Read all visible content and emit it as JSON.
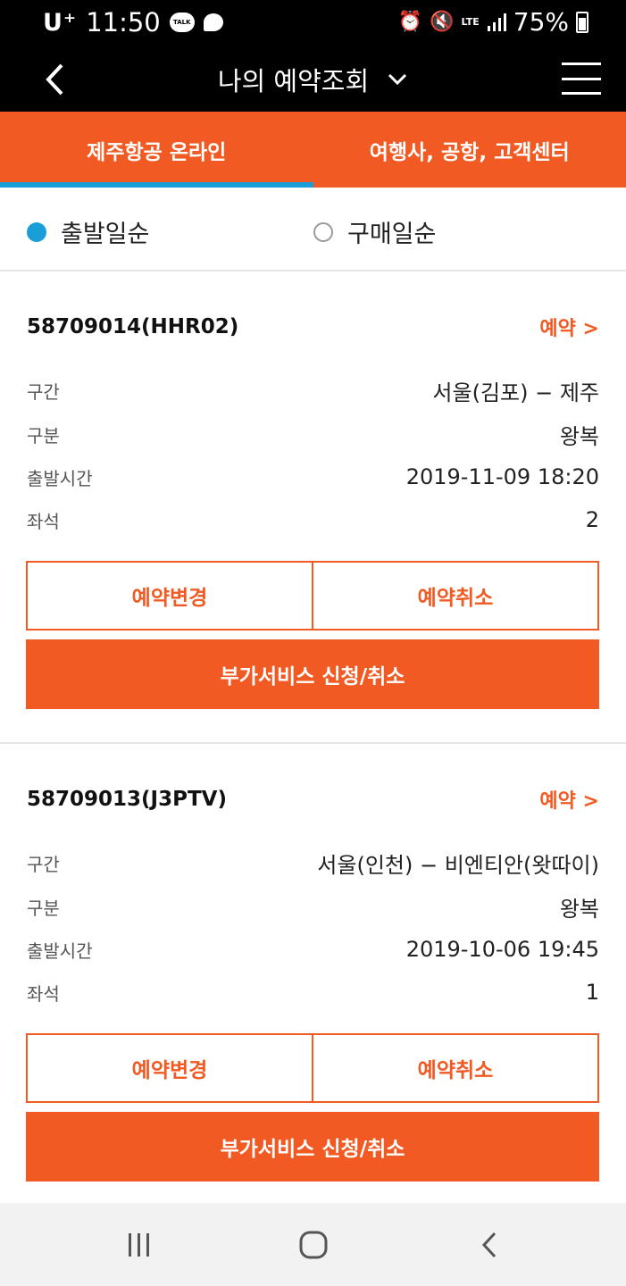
{
  "status_bar": {
    "carrier": "U⁺",
    "time": "11:50",
    "kakao_badge": "TALK",
    "network": "LTE",
    "battery": "75%"
  },
  "header": {
    "title": "나의 예약조회"
  },
  "tabs": [
    {
      "label": "제주항공 온라인",
      "active": true
    },
    {
      "label": "여행사, 공항, 고객센터",
      "active": false
    }
  ],
  "sort_options": [
    {
      "label": "출발일순",
      "selected": true
    },
    {
      "label": "구매일순",
      "selected": false
    }
  ],
  "reservations": [
    {
      "code": "58709014(HHR02)",
      "status": "예약 >",
      "rows": [
        {
          "label": "구간",
          "value": "서울(김포) − 제주"
        },
        {
          "label": "구분",
          "value": "왕복"
        },
        {
          "label": "출발시간",
          "value": "2019-11-09 18:20"
        },
        {
          "label": "좌석",
          "value": "2"
        }
      ],
      "change_label": "예약변경",
      "cancel_label": "예약취소",
      "extra_label": "부가서비스 신청/취소"
    },
    {
      "code": "58709013(J3PTV)",
      "status": "예약 >",
      "rows": [
        {
          "label": "구간",
          "value": "서울(인천) − 비엔티안(왓따이)"
        },
        {
          "label": "구분",
          "value": "왕복"
        },
        {
          "label": "출발시간",
          "value": "2019-10-06 19:45"
        },
        {
          "label": "좌석",
          "value": "1"
        }
      ],
      "change_label": "예약변경",
      "cancel_label": "예약취소",
      "extra_label": "부가서비스 신청/취소"
    }
  ],
  "colors": {
    "brand_orange": "#f15a22",
    "tab_indicator": "#1a9ed8",
    "header_bg": "#000000"
  },
  "icons": {
    "back": "chevron-left-icon",
    "title_dropdown": "chevron-down-icon",
    "menu": "hamburger-menu-icon",
    "nav_recent": "recent-apps-icon",
    "nav_home": "home-icon",
    "nav_back": "back-icon"
  }
}
